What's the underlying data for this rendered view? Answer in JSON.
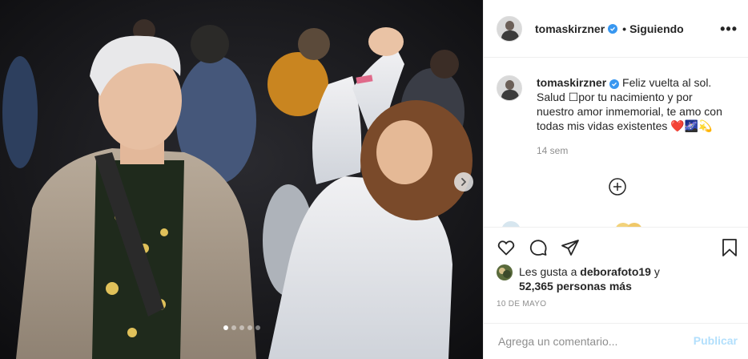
{
  "post": {
    "image_alt": "Fotografía de una fiesta nocturna",
    "carousel": {
      "total": 5,
      "active_index": 0
    }
  },
  "header": {
    "username": "tomaskirzner",
    "separator": "•",
    "follow_status": "Siguiendo",
    "more_label": "•••"
  },
  "caption": {
    "username": "tomaskirzner",
    "text": "Feliz vuelta al sol. Salud ☐por tu nacimiento y por nuestro amor inmemorial, te amo con todas mis vidas existentes ❤️🌌💫",
    "time": "14 sem"
  },
  "likes": {
    "prefix": "Les gusta a",
    "user": "deborafoto19",
    "conjunction": "y",
    "others": "52,365 personas más"
  },
  "date": "10 DE MAYO",
  "comment": {
    "placeholder": "Agrega un comentario...",
    "publish_label": "Publicar"
  },
  "colors": {
    "accent": "#3897f0",
    "publish_disabled": "#b2dffc",
    "text": "#262626",
    "muted": "#8e8e8e"
  },
  "icons": [
    "verified-icon",
    "more-icon",
    "next-arrow-icon",
    "add-comment-icon",
    "heart-icon",
    "comment-icon",
    "share-icon",
    "bookmark-icon"
  ]
}
